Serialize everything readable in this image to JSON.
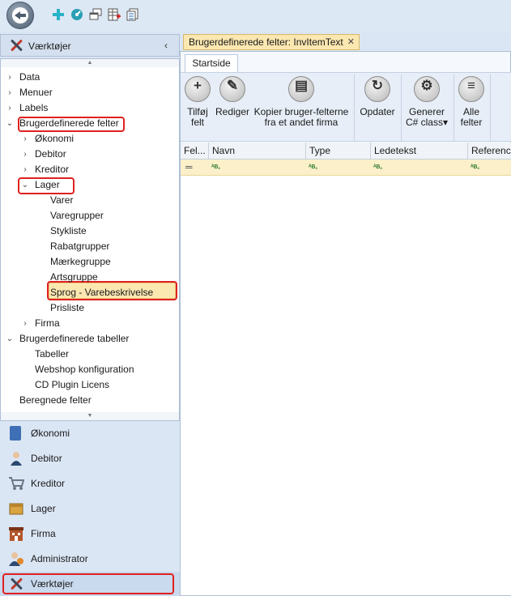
{
  "doc_tab": {
    "title": "Brugerdefinerede felter: InvItemText",
    "close": "✕"
  },
  "left_panel": {
    "title": "Værktøjer",
    "collapse": "‹"
  },
  "tree": [
    {
      "label": "Data",
      "chev": "›"
    },
    {
      "label": "Menuer",
      "chev": "›"
    },
    {
      "label": "Labels",
      "chev": "›"
    },
    {
      "label": "Brugerdefinerede felter",
      "chev": "⌄"
    },
    {
      "label": "Økonomi",
      "chev": "›"
    },
    {
      "label": "Debitor",
      "chev": "›"
    },
    {
      "label": "Kreditor",
      "chev": "›"
    },
    {
      "label": "Lager",
      "chev": "⌄"
    },
    {
      "label": "Varer",
      "chev": ""
    },
    {
      "label": "Varegrupper",
      "chev": ""
    },
    {
      "label": "Stykliste",
      "chev": ""
    },
    {
      "label": "Rabatgrupper",
      "chev": ""
    },
    {
      "label": "Mærkegruppe",
      "chev": ""
    },
    {
      "label": "Artsgruppe",
      "chev": ""
    },
    {
      "label": "Sprog - Varebeskrivelse",
      "chev": ""
    },
    {
      "label": "Prisliste",
      "chev": ""
    },
    {
      "label": "Firma",
      "chev": "›"
    },
    {
      "label": "Brugerdefinerede tabeller",
      "chev": "⌄"
    },
    {
      "label": "Tabeller",
      "chev": ""
    },
    {
      "label": "Webshop konfiguration",
      "chev": ""
    },
    {
      "label": "CD Plugin Licens",
      "chev": ""
    },
    {
      "label": "Beregnede felter",
      "chev": ""
    }
  ],
  "nav_sections": [
    {
      "label": "Økonomi",
      "icon": "ledger-icon",
      "color": "#3f6fb5"
    },
    {
      "label": "Debitor",
      "icon": "person-icon",
      "color": "#2b4a73"
    },
    {
      "label": "Kreditor",
      "icon": "cart-icon",
      "color": "#7d8a99"
    },
    {
      "label": "Lager",
      "icon": "box-icon",
      "color": "#d9a441"
    },
    {
      "label": "Firma",
      "icon": "building-icon",
      "color": "#b5552b"
    },
    {
      "label": "Administrator",
      "icon": "admin-icon",
      "color": "#e08a2a"
    },
    {
      "label": "Værktøjer",
      "icon": "tools-icon",
      "color": "#c0392b"
    }
  ],
  "ribbon": {
    "tab": "Startside",
    "buttons": [
      {
        "line1": "Tilføj",
        "line2": "felt",
        "glyph": "+"
      },
      {
        "line1": "Rediger",
        "line2": "",
        "glyph": "✎"
      },
      {
        "line1": "Kopier bruger-felterne",
        "line2": "fra et andet firma",
        "glyph": "▤"
      },
      {
        "line1": "Opdater",
        "line2": "",
        "glyph": "↻"
      },
      {
        "line1": "Generer",
        "line2": "C# class▾",
        "glyph": "⚙"
      },
      {
        "line1": "Alle",
        "line2": "felter",
        "glyph": "≡"
      }
    ]
  },
  "grid": {
    "columns": [
      "Fel...",
      "Navn",
      "Type",
      "Ledetekst",
      "Reference"
    ],
    "row": [
      "═",
      "ᴬB꜀",
      "ᴬB꜀",
      "ᴬB꜀",
      "ᴬB꜀"
    ]
  },
  "colors": {
    "highlight": "#e02020",
    "selected": "#fbe7b0",
    "panel": "#dbe6f4"
  }
}
